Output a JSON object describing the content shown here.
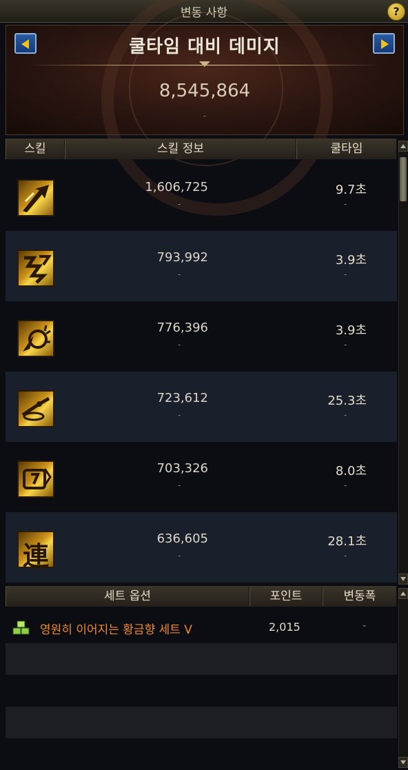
{
  "window": {
    "title": "변동 사항",
    "help_label": "?"
  },
  "banner": {
    "title": "쿨타임 대비 데미지",
    "value": "8,545,864",
    "sub": "-"
  },
  "skill_table": {
    "headers": {
      "skill": "스킬",
      "info": "스킬 정보",
      "cooldown": "쿨타임"
    },
    "rows": [
      {
        "icon": "lightning-arrow-icon",
        "glyph": "",
        "damage": "1,606,725",
        "damage_change": "-",
        "cooldown": "9.7초",
        "cooldown_change": "-"
      },
      {
        "icon": "zigzag-strike-icon",
        "glyph": "",
        "damage": "793,992",
        "damage_change": "-",
        "cooldown": "3.9초",
        "cooldown_change": "-"
      },
      {
        "icon": "radiant-burst-icon",
        "glyph": "",
        "damage": "776,396",
        "damage_change": "-",
        "cooldown": "3.9초",
        "cooldown_change": "-"
      },
      {
        "icon": "swirl-dash-icon",
        "glyph": "",
        "damage": "723,612",
        "damage_change": "-",
        "cooldown": "25.3초",
        "cooldown_change": "-"
      },
      {
        "icon": "shield-strike-icon",
        "glyph": "",
        "damage": "703,326",
        "damage_change": "-",
        "cooldown": "8.0초",
        "cooldown_change": "-"
      },
      {
        "icon": "chain-combo-icon",
        "glyph": "連",
        "damage": "636,605",
        "damage_change": "-",
        "cooldown": "28.1초",
        "cooldown_change": "-"
      }
    ]
  },
  "set_table": {
    "headers": {
      "name": "세트 옵션",
      "point": "포인트",
      "change": "변동폭"
    },
    "rows": [
      {
        "icon": "set-item-icon",
        "name": "영원히 이어지는 황금향 세트 V",
        "point": "2,015",
        "change": "-"
      }
    ]
  },
  "colors": {
    "accent_gold": "#f2c21a",
    "set_name": "#f08a22"
  }
}
